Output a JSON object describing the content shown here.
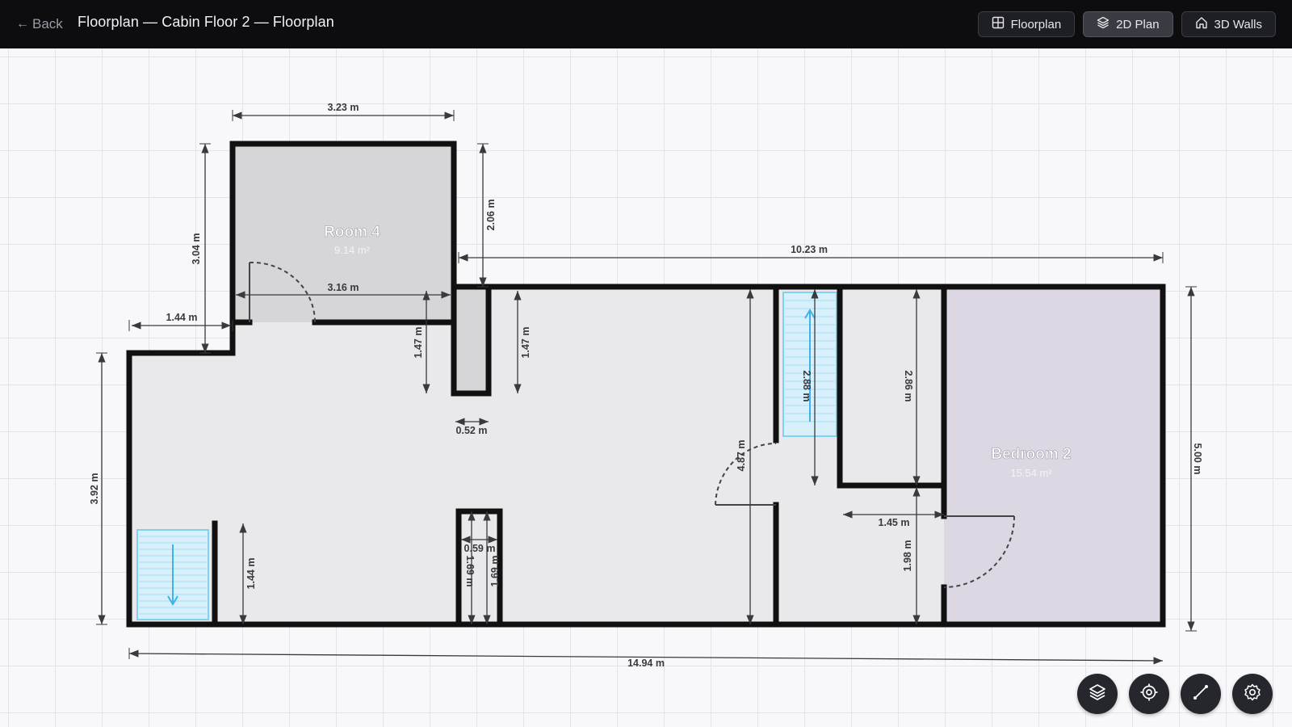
{
  "header": {
    "back_label": "Back",
    "title": "Floorplan — Cabin Floor 2 — Floorplan",
    "tabs": [
      {
        "label": "Floorplan",
        "icon": "grid-icon"
      },
      {
        "label": "2D Plan",
        "icon": "layers-icon",
        "active": true
      },
      {
        "label": "3D Walls",
        "icon": "home-icon"
      }
    ]
  },
  "rooms": [
    {
      "name": "Room 4",
      "area": "9.14 m²"
    },
    {
      "name": "Bedroom 2",
      "area": "15.54 m²"
    }
  ],
  "dimensions": [
    "3.23 m",
    "2.06 m",
    "3.04 m",
    "10.23 m",
    "3.16 m",
    "1.44 m",
    "1.47 m",
    "1.47 m",
    "0.52 m",
    "3.92 m",
    "1.44 m",
    "0.59 m",
    "1.69 m",
    "1.69 m",
    "4.87 m",
    "2.88 m",
    "2.86 m",
    "1.45 m",
    "1.98 m",
    "5.00 m",
    "14.94 m"
  ],
  "toolbar": [
    {
      "icon": "layers-icon"
    },
    {
      "icon": "target-icon"
    },
    {
      "icon": "ruler-icon"
    },
    {
      "icon": "gear-icon"
    }
  ],
  "colors": {
    "topbar": "#0d0d0f",
    "wall": "#111111",
    "floor": "#e9e9eb",
    "room4": "#d6d6d8",
    "bedroom2": "#ddd6e3",
    "stairs": "#5bc3ee"
  }
}
